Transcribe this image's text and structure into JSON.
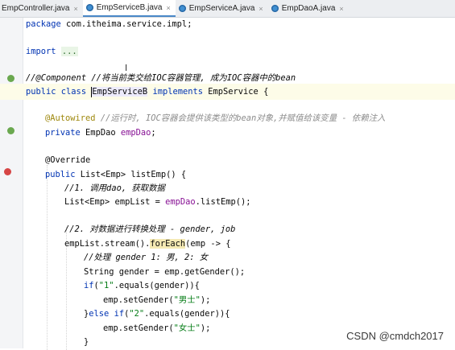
{
  "tabs": [
    {
      "label": "EmpController.java",
      "active": false
    },
    {
      "label": "EmpServiceB.java",
      "active": true
    },
    {
      "label": "EmpServiceA.java",
      "active": false
    },
    {
      "label": "EmpDaoA.java",
      "active": false
    }
  ],
  "close_glyph": "×",
  "code": {
    "l1": {
      "kw": "package",
      "rest": " com.itheima.service.impl;"
    },
    "l2": {
      "kw": "import",
      "fold": "..."
    },
    "l3": {
      "comment": "//@Component //将当前类交给IOC容器管理, 成为IOC容器中的bean"
    },
    "l4": {
      "kw1": "public class",
      "cls": "EmpServiceB",
      "kw2": "implements",
      "rest": " EmpService {"
    },
    "l5": {
      "ann": "@Autowired",
      "comment": " //运行时, IOC容器会提供该类型的bean对象,并赋值给该变量 - 依赖注入"
    },
    "l6": {
      "kw": "private",
      "type": " EmpDao ",
      "field": "empDao",
      "rest": ";"
    },
    "l7": {
      "ann": "@Override"
    },
    "l8": {
      "kw": "public",
      "rest": " List<Emp> listEmp() {"
    },
    "l9": {
      "comment": "//1. 调用dao, 获取数据"
    },
    "l10": {
      "pre": "List<Emp> empList = ",
      "field": "empDao",
      "rest": ".listEmp();"
    },
    "l11": {
      "comment": "//2. 对数据进行转换处理 - gender, job"
    },
    "l12": {
      "pre": "empList.stream().",
      "call": "forEach",
      "rest": "(emp -> {"
    },
    "l13": {
      "comment": "//处理 gender 1: 男, 2: 女"
    },
    "l14": {
      "rest": "String gender = emp.getGender();"
    },
    "l15": {
      "kw": "if",
      "p1": "(",
      "str": "\"1\"",
      "rest": ".equals(gender)){"
    },
    "l16": {
      "pre": "emp.setGender(",
      "str": "\"男士\"",
      "rest": ");"
    },
    "l17": {
      "p1": "}",
      "kw1": "else",
      "sp": " ",
      "kw2": "if",
      "p2": "(",
      "str": "\"2\"",
      "rest": ".equals(gender)){"
    },
    "l18": {
      "pre": "emp.setGender(",
      "str": "\"女士\"",
      "rest": ");"
    },
    "l19": {
      "rest": "}"
    }
  },
  "ibeam": "I",
  "watermark": "CSDN @cmdch2017"
}
